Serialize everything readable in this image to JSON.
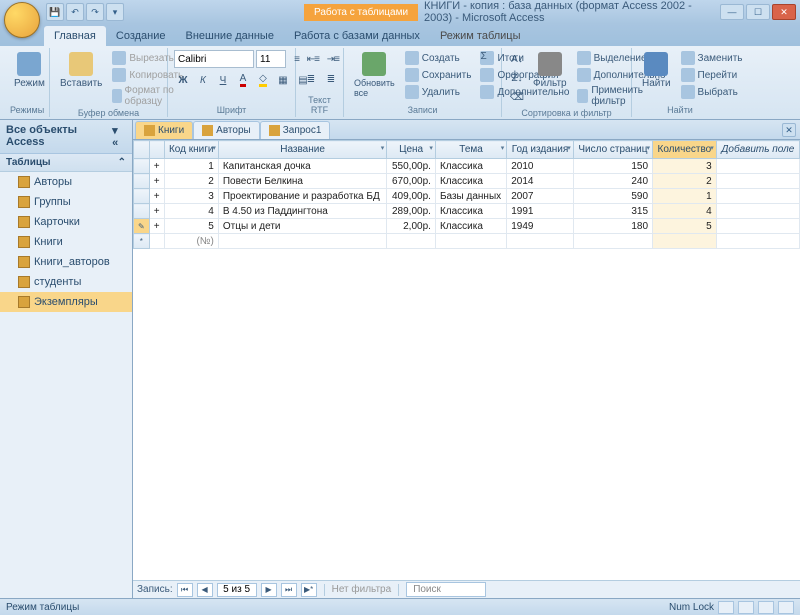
{
  "title": {
    "tabtool": "Работа с таблицами",
    "text": "КНИГИ - копия : база данных (формат Access 2002 - 2003) - Microsoft Access"
  },
  "ribbon_tabs": [
    "Главная",
    "Создание",
    "Внешние данные",
    "Работа с базами данных",
    "Режим таблицы"
  ],
  "ribbon": {
    "modes": {
      "label": "Режим",
      "group": "Режимы"
    },
    "clipboard": {
      "paste": "Вставить",
      "cut": "Вырезать",
      "copy": "Копировать",
      "painter": "Формат по образцу",
      "group": "Буфер обмена"
    },
    "font": {
      "name": "Calibri",
      "size": "11",
      "group": "Шрифт"
    },
    "rtf": {
      "group": "Текст RTF"
    },
    "records": {
      "refresh": "Обновить все",
      "new": "Создать",
      "save": "Сохранить",
      "delete": "Удалить",
      "totals": "Итоги",
      "spelling": "Орфография",
      "more": "Дополнительно",
      "group": "Записи"
    },
    "sortfilter": {
      "filter": "Фильтр",
      "selection": "Выделение",
      "advanced": "Дополнительно",
      "toggle": "Применить фильтр",
      "group": "Сортировка и фильтр"
    },
    "find": {
      "find": "Найти",
      "replace": "Заменить",
      "goto": "Перейти",
      "select": "Выбрать",
      "group": "Найти"
    }
  },
  "nav": {
    "head": "Все объекты Access",
    "section": "Таблицы",
    "items": [
      "Авторы",
      "Группы",
      "Карточки",
      "Книги",
      "Книги_авторов",
      "студенты",
      "Экземпляры"
    ],
    "selected": 6
  },
  "doc_tabs": [
    {
      "label": "Книги",
      "active": true
    },
    {
      "label": "Авторы",
      "active": false
    },
    {
      "label": "Запрос1",
      "active": false
    }
  ],
  "columns": [
    "Код книги",
    "Название",
    "Цена",
    "Тема",
    "Год издания",
    "Число страниц",
    "Количество"
  ],
  "add_field": "Добавить поле",
  "highlight_col": 6,
  "rows": [
    {
      "id": 1,
      "title": "Капитанская дочка",
      "price": "550,00р.",
      "subject": "Классика",
      "year": "2010",
      "pages": 150,
      "qty": 3
    },
    {
      "id": 2,
      "title": "Повести Белкина",
      "price": "670,00р.",
      "subject": "Классика",
      "year": "2014",
      "pages": 240,
      "qty": 2
    },
    {
      "id": 3,
      "title": "Проектирование и разработка БД",
      "price": "409,00р.",
      "subject": "Базы данных",
      "year": "2007",
      "pages": 590,
      "qty": 1
    },
    {
      "id": 4,
      "title": "В 4.50 из Паддингтона",
      "price": "289,00р.",
      "subject": "Классика",
      "year": "1991",
      "pages": 315,
      "qty": 4
    },
    {
      "id": 5,
      "title": "Отцы и дети",
      "price": "2,00р.",
      "subject": "Классика",
      "year": "1949",
      "pages": 180,
      "qty": 5
    }
  ],
  "editing_row": 4,
  "new_row_placeholder": "(№)",
  "recnav": {
    "label": "Запись:",
    "pos": "5 из 5",
    "nofilter": "Нет фильтра",
    "search": "Поиск"
  },
  "status": {
    "mode": "Режим таблицы",
    "numlock": "Num Lock"
  }
}
